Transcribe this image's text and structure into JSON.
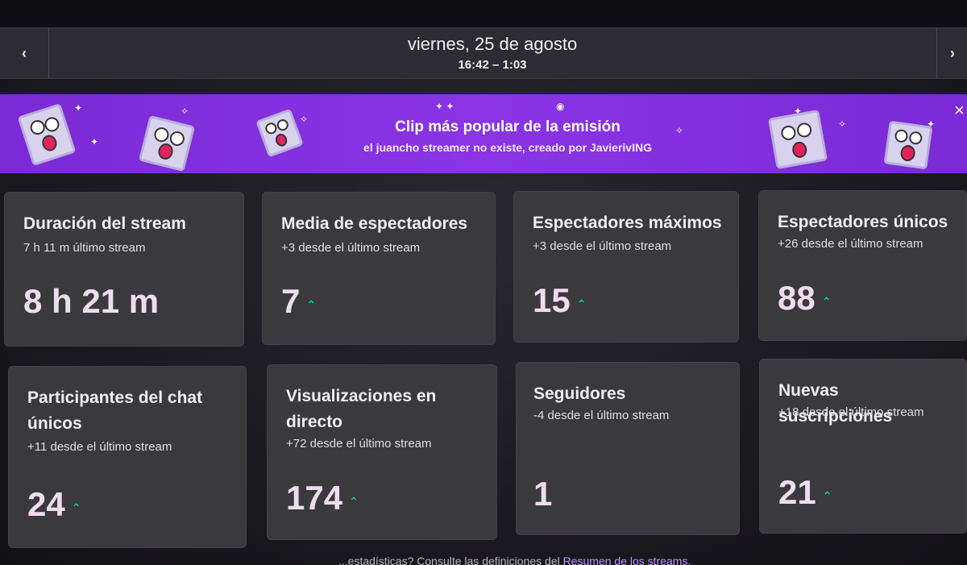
{
  "date_nav": {
    "prev_icon": "chevron-left-icon",
    "next_icon": "chevron-right-icon",
    "date": "viernes, 25 de agosto",
    "time_range": "16:42 – 1:03"
  },
  "clip_banner": {
    "title": "Clip más popular de la emisión",
    "subtitle": "el juancho streamer no existe, creado por JavierivING",
    "close_label": "×",
    "background": "#8a34e6"
  },
  "stats": [
    {
      "title": "Duración del stream",
      "delta": "7 h 11 m último stream",
      "value": "8 h 21 m",
      "trend": ""
    },
    {
      "title": "Media de espectadores",
      "delta": "+3 desde el último stream",
      "value": "7",
      "trend": "up"
    },
    {
      "title": "Espectadores máximos",
      "delta": "+3 desde el último stream",
      "value": "15",
      "trend": "up"
    },
    {
      "title": "Espectadores únicos",
      "delta": "+26 desde el último stream",
      "value": "88",
      "trend": "up"
    },
    {
      "title": "Participantes del chat únicos",
      "delta": "+11 desde el último stream",
      "value": "24",
      "trend": "up"
    },
    {
      "title": "Visualizaciones en directo",
      "delta": "+72 desde el último stream",
      "value": "174",
      "trend": "up"
    },
    {
      "title": "Seguidores",
      "delta": "-4 desde el último stream",
      "value": "1",
      "trend": ""
    },
    {
      "title": "Nuevas suscripciones",
      "delta": "+18 desde el último stream",
      "value": "21",
      "trend": "up"
    }
  ],
  "footer": {
    "text": "...estadísticas? Consulte las definiciones del ",
    "link": "Resumen de los streams."
  },
  "colors": {
    "accent": "#9147ff",
    "trend_up": "#00d68f",
    "card_bg": "#3a3a3d"
  }
}
